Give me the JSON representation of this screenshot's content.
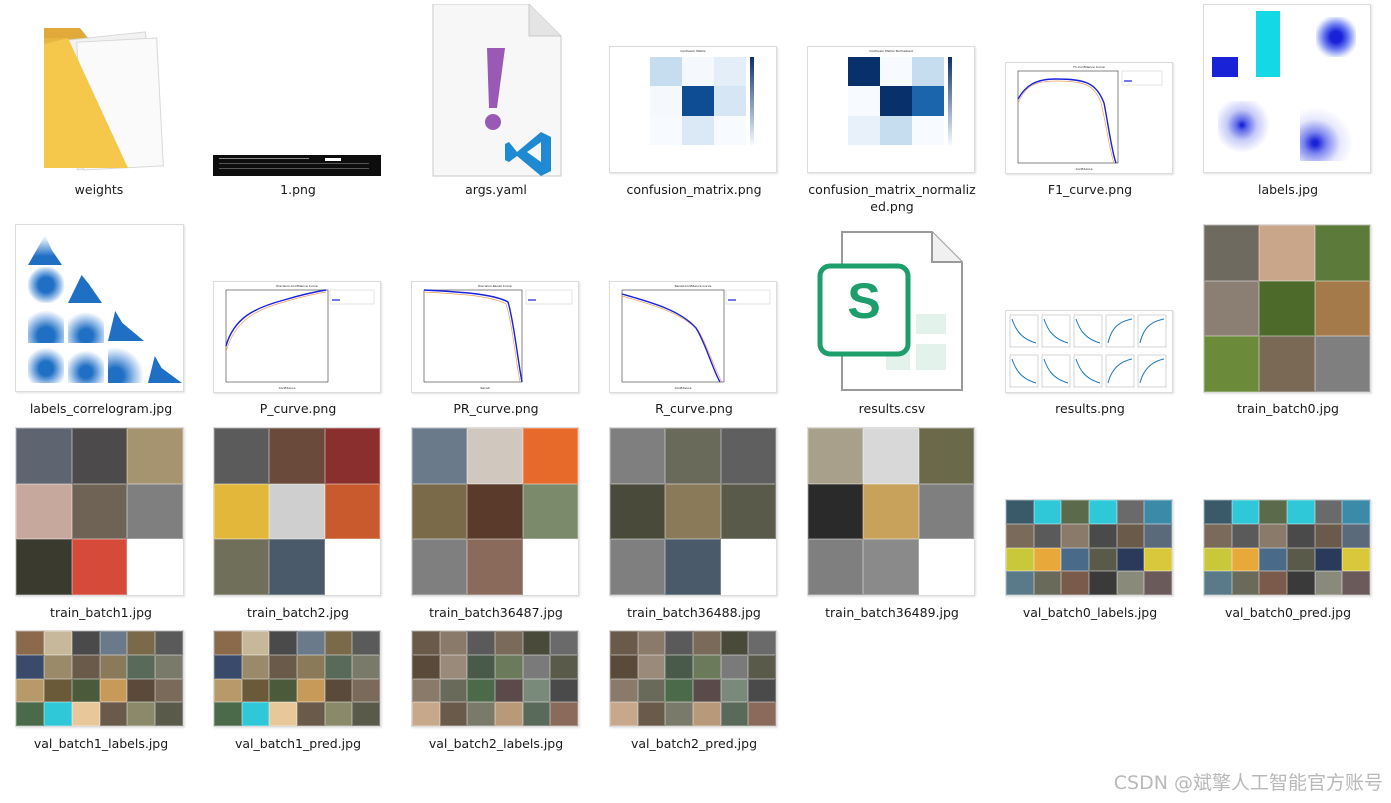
{
  "files": [
    {
      "name": "weights",
      "type": "folder",
      "icon": "folder-icon"
    },
    {
      "name": "1.png",
      "type": "image"
    },
    {
      "name": "args.yaml",
      "type": "yaml",
      "icon": "vscode-file-icon"
    },
    {
      "name": "confusion_matrix.png",
      "type": "image"
    },
    {
      "name": "confusion_matrix_normalized.png",
      "type": "image"
    },
    {
      "name": "F1_curve.png",
      "type": "image"
    },
    {
      "name": "labels.jpg",
      "type": "image"
    },
    {
      "name": "labels_correlogram.jpg",
      "type": "image"
    },
    {
      "name": "P_curve.png",
      "type": "image"
    },
    {
      "name": "PR_curve.png",
      "type": "image"
    },
    {
      "name": "R_curve.png",
      "type": "image"
    },
    {
      "name": "results.csv",
      "type": "csv",
      "icon": "spreadsheet-file-icon",
      "icon_letter": "S"
    },
    {
      "name": "results.png",
      "type": "image"
    },
    {
      "name": "train_batch0.jpg",
      "type": "image"
    },
    {
      "name": "train_batch1.jpg",
      "type": "image"
    },
    {
      "name": "train_batch2.jpg",
      "type": "image"
    },
    {
      "name": "train_batch36487.jpg",
      "type": "image"
    },
    {
      "name": "train_batch36488.jpg",
      "type": "image"
    },
    {
      "name": "train_batch36489.jpg",
      "type": "image"
    },
    {
      "name": "val_batch0_labels.jpg",
      "type": "image"
    },
    {
      "name": "val_batch0_pred.jpg",
      "type": "image"
    },
    {
      "name": "val_batch1_labels.jpg",
      "type": "image"
    },
    {
      "name": "val_batch1_pred.jpg",
      "type": "image"
    },
    {
      "name": "val_batch2_labels.jpg",
      "type": "image"
    },
    {
      "name": "val_batch2_pred.jpg",
      "type": "image"
    }
  ],
  "thumb_text": {
    "confusion_title": "Confusion Matrix",
    "confusion_norm_title": "Confusion Matrix Normalized",
    "f1_title": "F1-Confidence Curve",
    "p_title": "Precision-Confidence Curve",
    "pr_title": "Precision-Recall Curve",
    "r_title": "Recall-Confidence Curve",
    "xlabel_conf": "Confidence",
    "xlabel_recall": "Recall",
    "class_a": "no-vest",
    "class_b": "vest",
    "class_c": "background"
  },
  "colors": {
    "folder": "#f5c84c",
    "folder_dark": "#e0a93a",
    "yaml_mark": "#9b59b6",
    "vscode": "#1f8ad2",
    "sheet_green": "#1e9e6a",
    "curve_blue": "#1a22d8",
    "mosaic_gray": "#7f7f7f"
  },
  "watermark": "CSDN @斌擎人工智能官方账号"
}
